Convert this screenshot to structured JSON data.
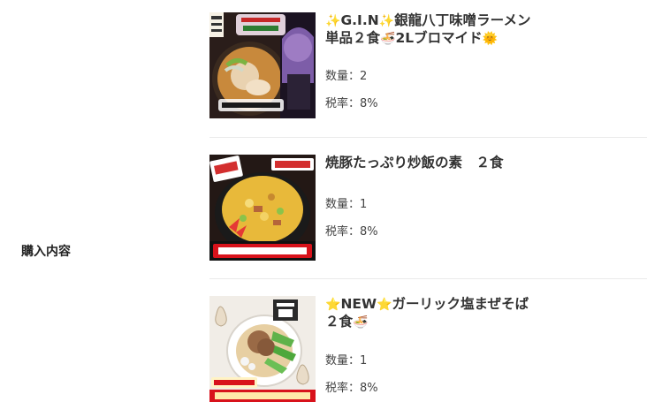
{
  "section": {
    "label": "購入内容"
  },
  "items": [
    {
      "title_prefix_icon": "✨",
      "title_part1": "G.I.N",
      "title_mid_icon": "✨",
      "title_part2": "銀龍八丁味噌ラーメン",
      "title_line2": "単品２食",
      "title_bowl_icon": "🍜",
      "title_part3": "2Lブロマイド",
      "title_suffix_icon": "🌞",
      "quantity": "数量：2",
      "tax": "税率：8%",
      "image_text_1": "銀龍八丁味噌ラーメン",
      "image_text_2": "金龍"
    },
    {
      "title_part1": "焼豚たっぷり炒飯の素　２食",
      "quantity": "数量：1",
      "tax": "税率：8%",
      "image_badge_left": "絶品!!",
      "image_badge_right": "名店の味!",
      "image_caption": "焼豚炒飯の素"
    },
    {
      "title_prefix_icon": "⭐",
      "title_part1": "NEW",
      "title_mid_icon": "⭐",
      "title_part2": "ガーリック塩まぜそば",
      "title_line2": "２食",
      "title_bowl_icon": "🍜",
      "quantity": "数量：1",
      "tax": "税率：8%",
      "image_badge": "大好評推し!",
      "image_caption": "ガーリック塩まぜそば",
      "image_brand": "銀龍"
    }
  ],
  "colors": {
    "divider": "#eaeaea",
    "text": "#333333",
    "caption_red": "#d8121b"
  }
}
